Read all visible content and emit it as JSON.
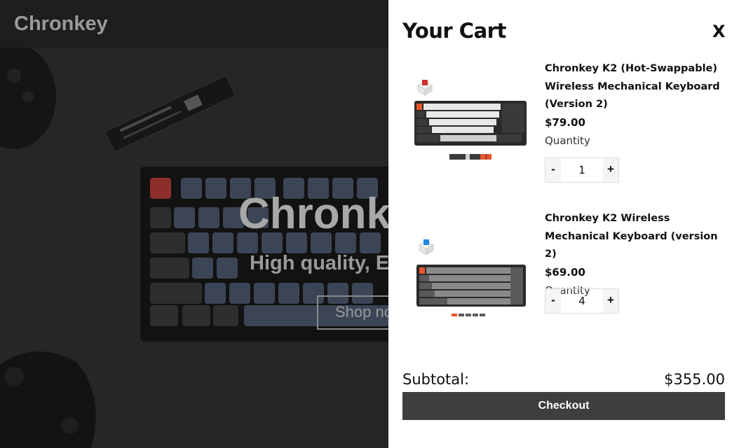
{
  "site": {
    "brand": "Chronkey"
  },
  "hero": {
    "title": "Chronkey",
    "subtitle": "High quality, E",
    "button_label": "Shop no"
  },
  "cart": {
    "title": "Your Cart",
    "close_label": "X",
    "items": [
      {
        "name": "Chronkey K2 (Hot-Swappable) Wireless Mechanical Keyboard (Version 2)",
        "price": "$79.00",
        "quantity_label": "Quantity",
        "quantity": "1",
        "minus_label": "-",
        "plus_label": "+",
        "switch_color": "#d32f2f",
        "keycap_style": "white-gray-orange"
      },
      {
        "name": "Chronkey K2 Wireless Mechanical Keyboard (version 2)",
        "price": "$69.00",
        "quantity_label": "Quantity",
        "quantity": "4",
        "minus_label": "-",
        "plus_label": "+",
        "switch_color": "#1e88e5",
        "keycap_style": "gray-orange"
      }
    ],
    "subtotal_label": "Subtotal:",
    "subtotal_value": "$355.00",
    "checkout_label": "Checkout"
  },
  "colors": {
    "checkout_bg": "#3e3e3e",
    "accent_orange": "#e8542c",
    "topbar_bg": "#1e1e1e"
  }
}
